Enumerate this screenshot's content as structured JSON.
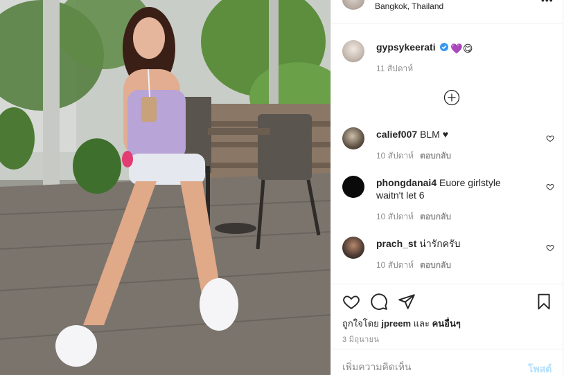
{
  "header": {
    "location": "Bangkok, Thailand",
    "more_icon": "ellipsis-icon"
  },
  "caption": {
    "username": "gypsykeerati",
    "verified": true,
    "emoji": "💜😋",
    "time": "11 สัปดาห์"
  },
  "comments": [
    {
      "username": "calief007",
      "text": "BLM ♥",
      "time": "10 สัปดาห์",
      "reply": "ตอบกลับ"
    },
    {
      "username": "phongdanai4",
      "text": "Euore girlstyle",
      "text2": "waitn't let 6",
      "time": "10 สัปดาห์",
      "reply": "ตอบกลับ"
    },
    {
      "username": "prach_st",
      "text": "น่ารักครับ",
      "time": "10 สัปดาห์",
      "reply": "ตอบกลับ"
    }
  ],
  "actions": {
    "liked_by_prefix": "ถูกใจโดย",
    "liked_by_user": "jpreem",
    "liked_by_and": "และ",
    "liked_by_others": "คนอื่นๆ",
    "date": "3 มิถุนายน"
  },
  "add_comment": {
    "placeholder": "เพิ่มความคิดเห็น",
    "post_label": "โพสต์"
  },
  "colors": {
    "link": "#0095f6",
    "post_disabled": "#b2dffc",
    "muted": "#8e8e8e",
    "verified": "#3897f0"
  }
}
